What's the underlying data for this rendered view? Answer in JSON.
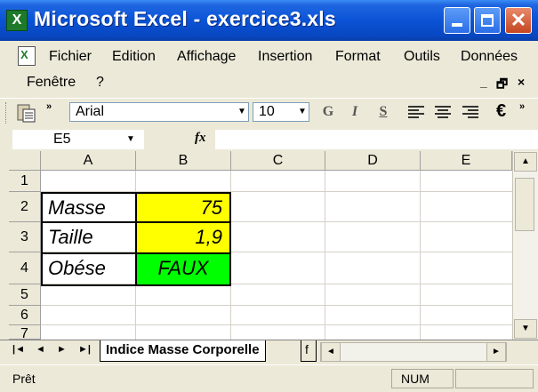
{
  "window": {
    "title": "Microsoft Excel - exercice3.xls",
    "app_icon": "excel-icon",
    "minimize_icon": "minimize-icon",
    "maximize_icon": "maximize-icon",
    "close_icon": "close-icon"
  },
  "menu": {
    "items": [
      "Fichier",
      "Edition",
      "Affichage",
      "Insertion",
      "Format",
      "Outils",
      "Données",
      "Fenêtre",
      "?"
    ]
  },
  "toolbar": {
    "font": "Arial",
    "size": "10",
    "bold_label": "G",
    "italic_label": "I",
    "underline_label": "S",
    "currency_label": "€"
  },
  "formula_bar": {
    "name_box": "E5",
    "fx_label": "fx",
    "formula": ""
  },
  "grid": {
    "columns": [
      "A",
      "B",
      "C",
      "D",
      "E"
    ],
    "rows": [
      "1",
      "2",
      "3",
      "4",
      "5",
      "6",
      "7"
    ],
    "cells": {
      "A2": "Masse",
      "B2": "75",
      "A3": "Taille",
      "B3": "1,9",
      "A4": "Obése",
      "B4": "FAUX"
    },
    "colors": {
      "yellow": "#ffff00",
      "green": "#00ff00"
    }
  },
  "sheets": {
    "active": "Indice Masse Corporelle",
    "next_partial": "f"
  },
  "status": {
    "left": "Prêt",
    "num": "NUM"
  }
}
